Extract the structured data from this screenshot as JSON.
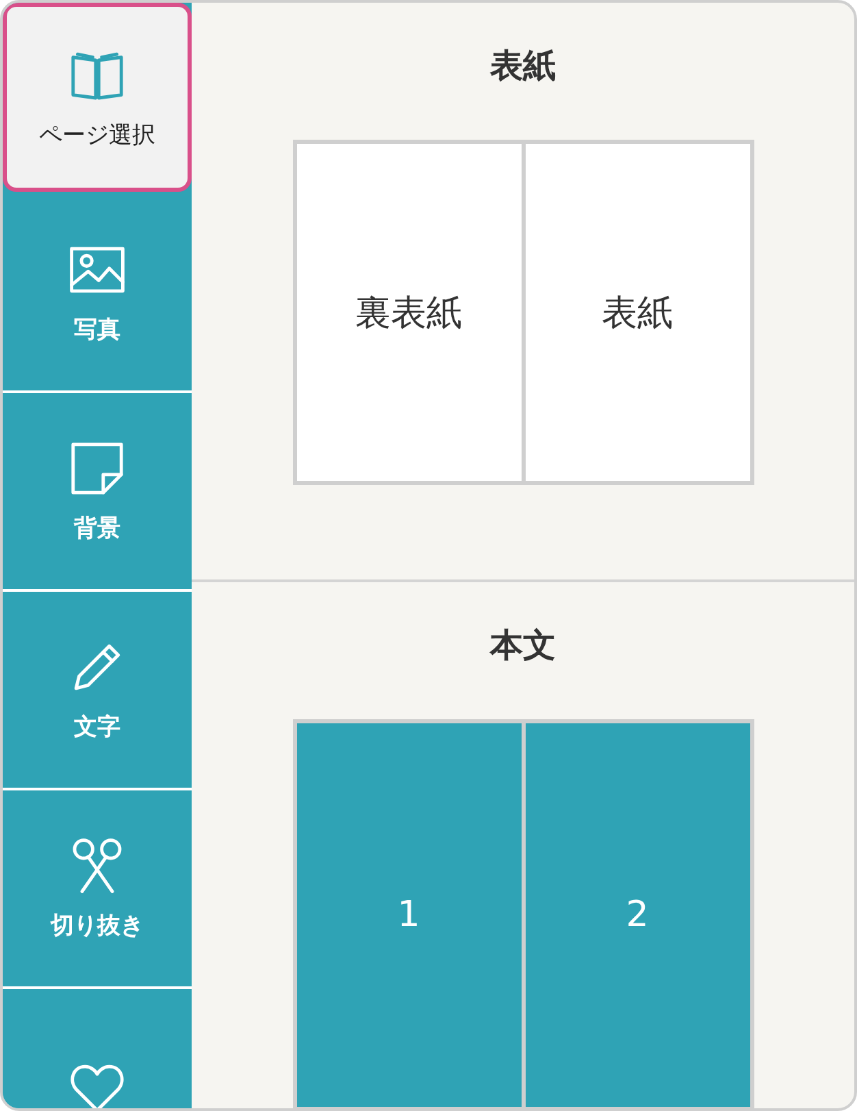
{
  "sidebar": {
    "items": [
      {
        "label": "ページ選択",
        "selected": true
      },
      {
        "label": "写真",
        "selected": false
      },
      {
        "label": "背景",
        "selected": false
      },
      {
        "label": "文字",
        "selected": false
      },
      {
        "label": "切り抜き",
        "selected": false
      },
      {
        "selected": false
      }
    ]
  },
  "sections": [
    {
      "title": "表紙",
      "pages": [
        {
          "label": "裏表紙",
          "kind": "cover"
        },
        {
          "label": "表紙",
          "kind": "cover"
        }
      ]
    },
    {
      "title": "本文",
      "pages": [
        {
          "label": "1",
          "kind": "body"
        },
        {
          "label": "2",
          "kind": "body"
        }
      ]
    }
  ]
}
